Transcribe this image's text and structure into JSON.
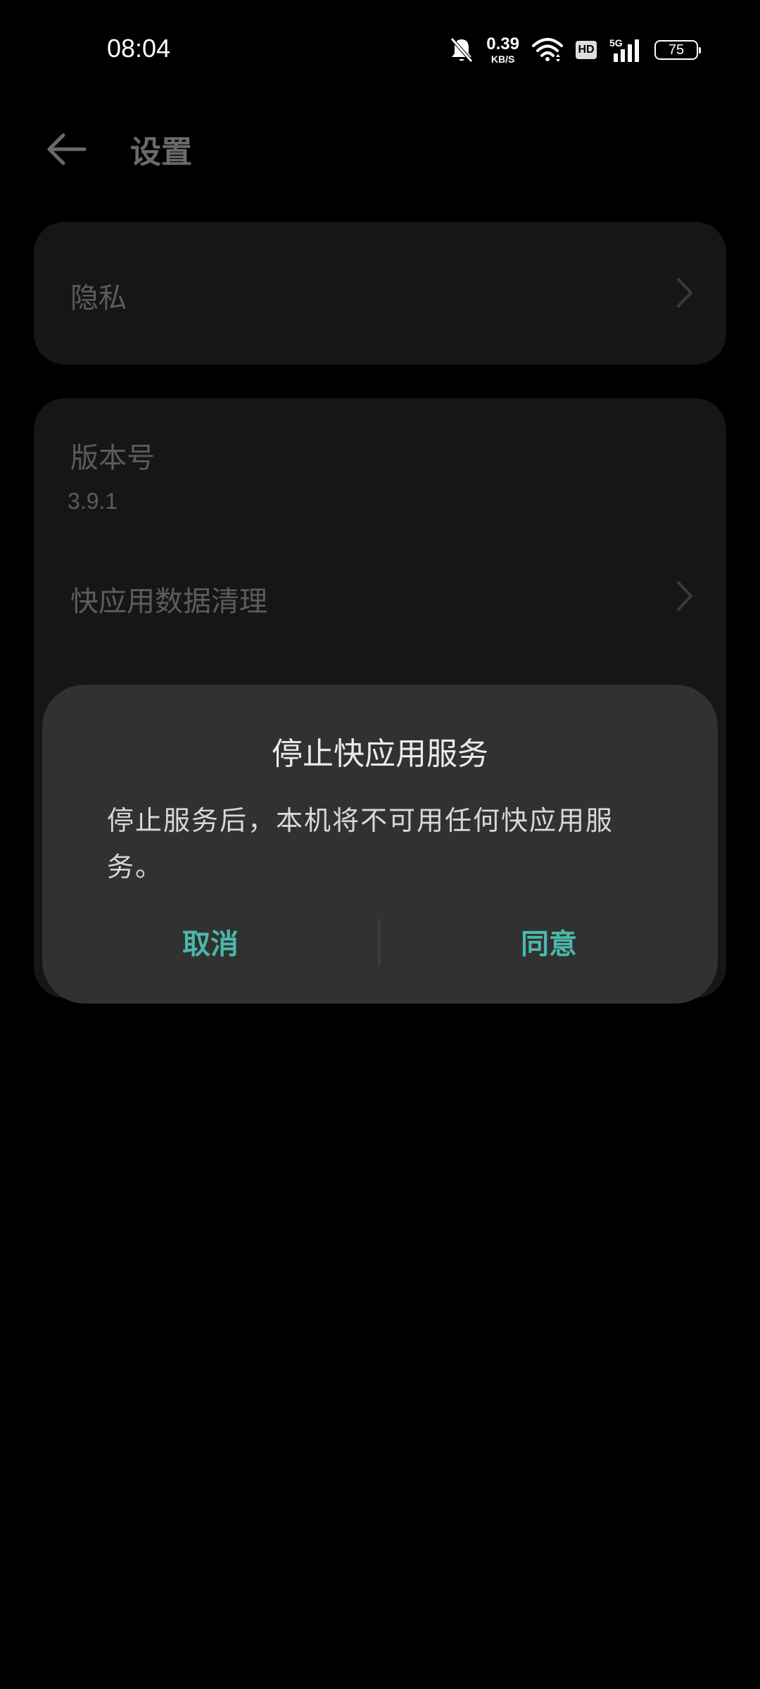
{
  "status_bar": {
    "time": "08:04",
    "net_speed_value": "0.39",
    "net_speed_unit": "KB/S",
    "hd_label": "HD",
    "network_type": "5G",
    "battery": "75",
    "icons": [
      "bell-muted-icon",
      "wifi-icon",
      "hd-icon",
      "signal-5g-icon",
      "battery-icon"
    ]
  },
  "header": {
    "title": "设置",
    "back_icon": "arrow-left-icon"
  },
  "settings": {
    "privacy_label": "隐私",
    "version_label": "版本号",
    "version_value": "3.9.1",
    "clear_data_label": "快应用数据清理"
  },
  "dialog": {
    "title": "停止快应用服务",
    "message": "停止服务后，本机将不可用任何快应用服务。",
    "cancel_label": "取消",
    "agree_label": "同意"
  },
  "colors": {
    "background": "#000000",
    "card": "#161616",
    "dialog": "#313131",
    "accent": "#4bb8aa"
  }
}
